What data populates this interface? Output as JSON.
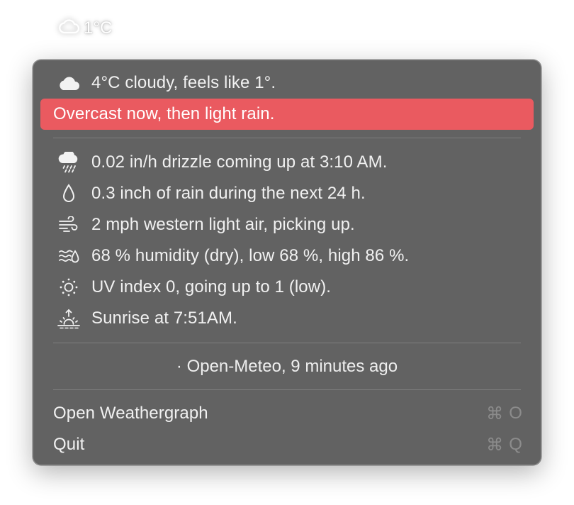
{
  "menubar": {
    "icon": "cloud-icon",
    "temp": "1°C"
  },
  "menu": {
    "header": {
      "icon": "cloud-icon",
      "text": "4°C cloudy, feels like 1°."
    },
    "highlight": {
      "text": "Overcast now, then light rain.",
      "color": "#ea5a60"
    },
    "details": [
      {
        "icon": "cloud-drizzle-icon",
        "text": "0.02 in/h drizzle coming up at 3:10 AM."
      },
      {
        "icon": "raindrop-icon",
        "text": "0.3 inch of rain during the next 24 h."
      },
      {
        "icon": "wind-icon",
        "text": "2 mph western light air, picking up."
      },
      {
        "icon": "humidity-icon",
        "text": "68 % humidity (dry), low 68 %, high 86 %."
      },
      {
        "icon": "sun-icon",
        "text": "UV index 0, going up to 1 (low)."
      },
      {
        "icon": "sunrise-icon",
        "text": "Sunrise at 7:51AM."
      }
    ],
    "source": "· Open-Meteo, 9 minutes ago",
    "actions": [
      {
        "label": "Open Weathergraph",
        "shortcut_symbol": "⌘",
        "shortcut_key": "O"
      },
      {
        "label": "Quit",
        "shortcut_symbol": "⌘",
        "shortcut_key": "Q"
      }
    ]
  }
}
